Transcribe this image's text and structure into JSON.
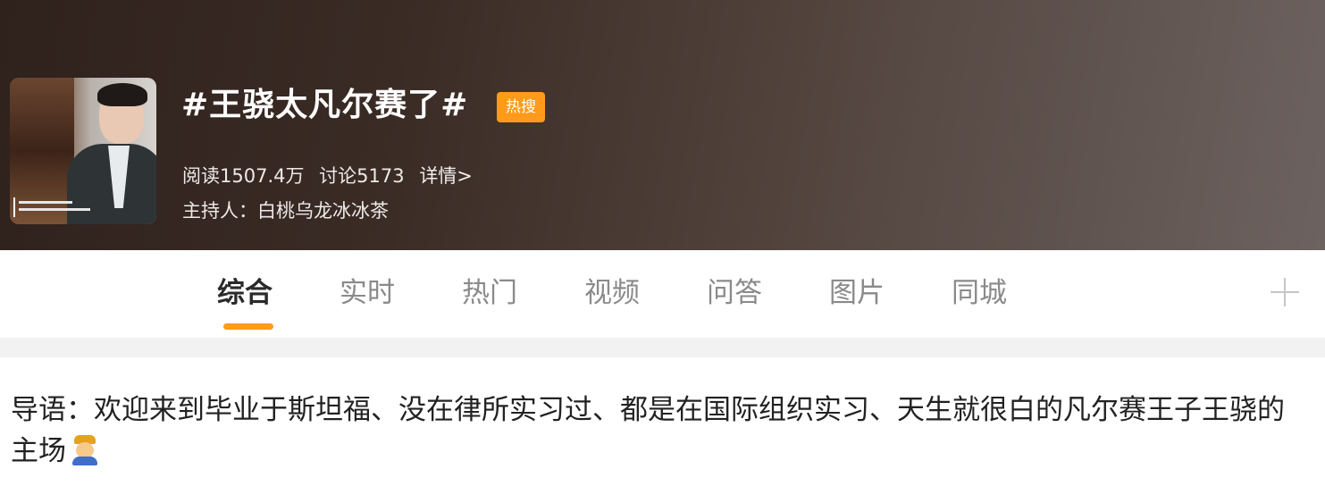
{
  "header": {
    "title": "#王骁太凡尔赛了#",
    "badge": "热搜",
    "stats": {
      "reads": "阅读1507.4万",
      "discussions": "讨论5173",
      "details_link": "详情>"
    },
    "host": "主持人：白桃乌龙冰冰茶",
    "colors": {
      "badge": "#ff9a1a"
    }
  },
  "tabs": {
    "items": [
      {
        "label": "综合",
        "active": true
      },
      {
        "label": "实时",
        "active": false
      },
      {
        "label": "热门",
        "active": false
      },
      {
        "label": "视频",
        "active": false
      },
      {
        "label": "问答",
        "active": false
      },
      {
        "label": "图片",
        "active": false
      },
      {
        "label": "同城",
        "active": false
      }
    ],
    "more_icon": "plus-icon",
    "colors": {
      "indicator": "#ff9a1a",
      "active_text": "#2a2a2a",
      "inactive_text": "#8a8a8a"
    }
  },
  "intro": {
    "text": "导语：欢迎来到毕业于斯坦福、没在律所实习过、都是在国际组织实习、天生就很白的凡尔赛王子王骁的主场",
    "emoji": "prince-emoji"
  }
}
